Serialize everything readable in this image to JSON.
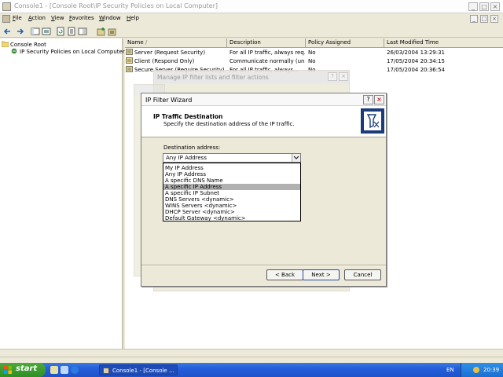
{
  "window": {
    "title": "Console1 - [Console Root\\IP Security Policies on Local Computer]",
    "min_glyph": "_",
    "max_glyph": "□",
    "close_glyph": "×"
  },
  "menu": {
    "items": [
      "File",
      "Action",
      "View",
      "Favorites",
      "Window",
      "Help"
    ]
  },
  "tree": {
    "root": "Console Root",
    "child": "IP Security Policies on Local Computer"
  },
  "list": {
    "columns": [
      "Name",
      "Description",
      "Policy Assigned",
      "Last Modified Time"
    ],
    "sort_glyph": "/",
    "rows": [
      {
        "name": "Server (Request Security)",
        "description": "For all IP traffic, always req...",
        "assigned": "No",
        "modified": "26/03/2004 13:29:31"
      },
      {
        "name": "Client (Respond Only)",
        "description": "Communicate normally (uns...",
        "assigned": "No",
        "modified": "17/05/2004 20:34:15"
      },
      {
        "name": "Secure Server (Require Security)",
        "description": "For all IP traffic, always...",
        "assigned": "No",
        "modified": "17/05/2004 20:36:54"
      }
    ]
  },
  "ghost_dialog": {
    "title": "Manage IP filter lists and filter actions",
    "help_glyph": "?",
    "close_glyph": "×"
  },
  "wizard": {
    "title": "IP Filter Wizard",
    "help_glyph": "?",
    "close_glyph": "×",
    "header_title": "IP Traffic Destination",
    "header_subtitle": "Specify the destination address of the IP traffic.",
    "dest_label": "Destination address:",
    "selected_value": "Any IP Address",
    "options": [
      "My IP Address",
      "Any IP Address",
      "A specific DNS Name",
      "A specific IP Address",
      "A specific IP Subnet",
      "DNS Servers <dynamic>",
      "WINS Servers <dynamic>",
      "DHCP Server <dynamic>",
      "Default Gateway <dynamic>"
    ],
    "highlighted_index": 3,
    "back_label": "< Back",
    "next_label": "Next >",
    "cancel_label": "Cancel"
  },
  "taskbar": {
    "start_label": "start",
    "task_label": "Console1 - [Console ...",
    "language": "EN",
    "clock": "20:39"
  },
  "colors": {
    "selection_gray": "#b0b0b0",
    "taskbar_blue": "#245edc",
    "start_green": "#3a9a2e"
  }
}
